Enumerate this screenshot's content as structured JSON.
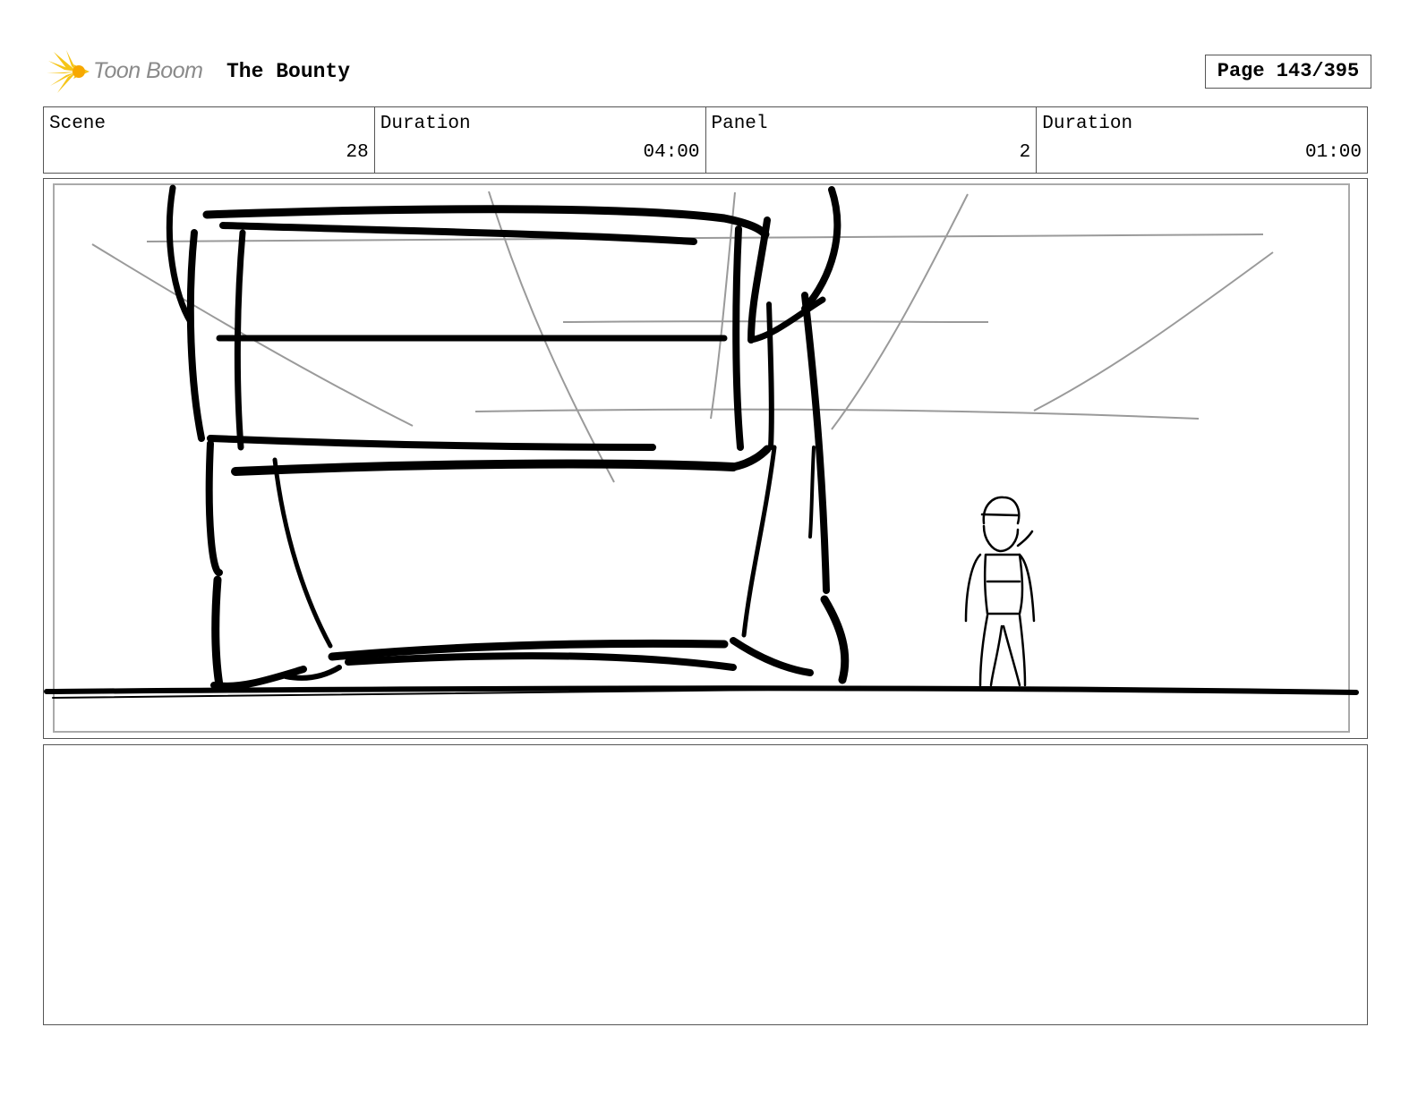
{
  "header": {
    "logo_text": "Toon Boom",
    "project_title": "The Bounty",
    "page_label": "Page 143/395"
  },
  "info": {
    "scene_label": "Scene",
    "scene_value": "28",
    "scene_duration_label": "Duration",
    "scene_duration_value": "04:00",
    "panel_label": "Panel",
    "panel_value": "2",
    "panel_duration_label": "Duration",
    "panel_duration_value": "01:00"
  },
  "notes": {
    "text": ""
  }
}
